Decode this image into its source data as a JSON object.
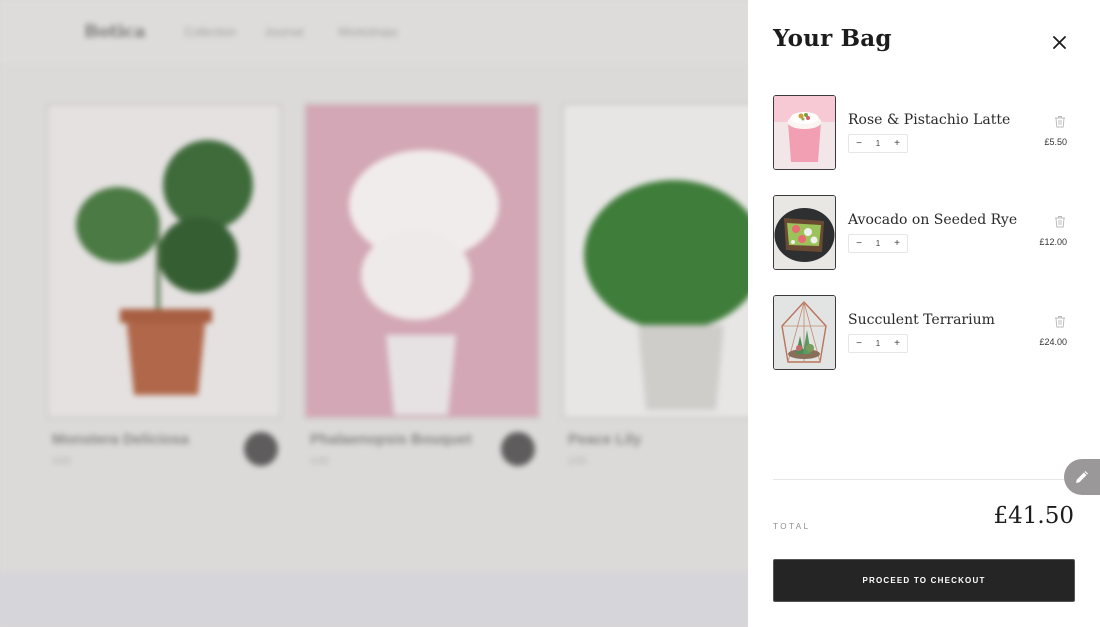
{
  "background": {
    "brand": "Botica",
    "nav": [
      "Collection",
      "Journal",
      "Workshops"
    ],
    "products": [
      {
        "title": "Monstera Deliciosa",
        "price": "£00"
      },
      {
        "title": "Phalaenopsis Bouquet",
        "price": "£00"
      },
      {
        "title": "Peace Lily",
        "price": "£00"
      }
    ]
  },
  "cart": {
    "title": "Your Bag",
    "items": [
      {
        "name": "Rose & Pistachio Latte",
        "qty": "1",
        "price": "£5.50",
        "icon": "latte"
      },
      {
        "name": "Avocado on Seeded Rye",
        "qty": "1",
        "price": "£12.00",
        "icon": "avocado-toast"
      },
      {
        "name": "Succulent Terrarium",
        "qty": "1",
        "price": "£24.00",
        "icon": "terrarium"
      }
    ],
    "qty_minus": "−",
    "qty_plus": "+",
    "total_label": "TOTAL",
    "total_value": "£41.50",
    "checkout_label": "PROCEED TO CHECKOUT"
  },
  "colors": {
    "accent": "#252525",
    "drawer_bg": "#ffffff",
    "overlay": "#dcd9d9"
  }
}
